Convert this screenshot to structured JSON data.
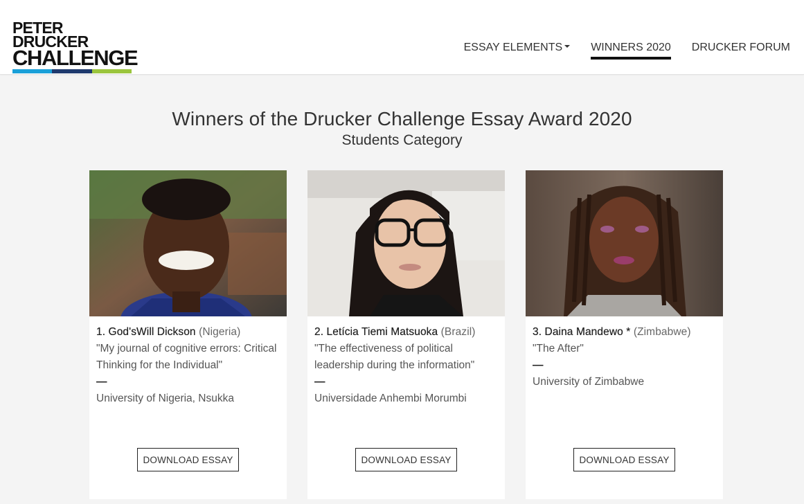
{
  "brand": {
    "line1": "PETER DRUCKER",
    "line2": "CHALLENGE",
    "stripe_colors": [
      "#1aa0d8",
      "#1f3a6e",
      "#9bc53d"
    ],
    "text_color": "#121212"
  },
  "nav": {
    "items": [
      {
        "label": "ESSAY ELEMENTS",
        "has_dropdown": true,
        "active": false
      },
      {
        "label": "WINNERS 2020",
        "has_dropdown": false,
        "active": true
      },
      {
        "label": "DRUCKER FORUM",
        "has_dropdown": false,
        "active": false
      }
    ]
  },
  "page": {
    "title": "Winners of the Drucker Challenge Essay Award 2020",
    "subtitle": "Students Category"
  },
  "winners": [
    {
      "rank_name": "1. God'sWill Dickson",
      "country": "(Nigeria)",
      "essay_title": "\"My journal of cognitive errors: Critical Thinking for the Individual\"",
      "dash": "—",
      "university": "University of Nigeria, Nsukka",
      "button_label": "DOWNLOAD ESSAY"
    },
    {
      "rank_name": "2. Letícia Tiemi Matsuoka",
      "country": "(Brazil)",
      "essay_title": "\"The effectiveness of political leadership during the information\"",
      "dash": "—",
      "university": "Universidade Anhembi Morumbi",
      "button_label": "DOWNLOAD ESSAY"
    },
    {
      "rank_name": "3. Daina Mandewo *",
      "country": "(Zimbabwe)",
      "essay_title": "\"The After\"",
      "dash": "—",
      "university": "University of Zimbabwe",
      "button_label": "DOWNLOAD ESSAY"
    }
  ],
  "colors": {
    "page_background": "#f4f4f4",
    "active_underline": "#111111"
  }
}
